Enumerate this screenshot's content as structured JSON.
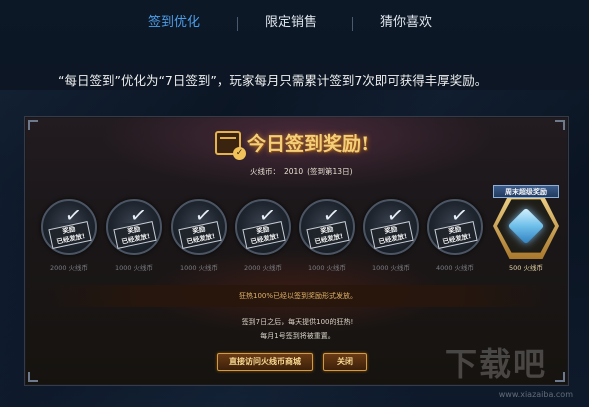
{
  "tabs": [
    {
      "label": "签到优化",
      "active": true
    },
    {
      "label": "限定销售",
      "active": false
    },
    {
      "label": "猜你喜欢",
      "active": false
    }
  ],
  "description": "“每日签到”优化为“7日签到”，玩家每月只需累计签到7次即可获得丰厚奖励。",
  "panel": {
    "title": "今日签到奖励!",
    "coin_label": "火线币：",
    "coin_value": "2010",
    "signed_days": "(签到第13日)",
    "stamp_line1": "奖励",
    "stamp_line2": "已经发放!",
    "rewards": [
      {
        "label": "2000 火线币",
        "claimed": true
      },
      {
        "label": "1000 火线币",
        "claimed": true
      },
      {
        "label": "1000 火线币",
        "claimed": true
      },
      {
        "label": "2000 火线币",
        "claimed": true
      },
      {
        "label": "1000 火线币",
        "claimed": true
      },
      {
        "label": "1000 火线币",
        "claimed": true
      },
      {
        "label": "4000 火线币",
        "claimed": true
      }
    ],
    "final_reward": {
      "tag": "周末超级奖励",
      "label": "500 火线币",
      "icon": "crystal-gem-icon"
    },
    "status_bar": "狂热100%已经以签到奖励形式发放。",
    "note1": "签到7日之后，每天提供100的狂热!",
    "note2": "每月1号签到将被重置。",
    "shop_button": "直接访问火线币商城",
    "close_button": "关闭"
  },
  "watermark": {
    "text": "下载吧",
    "url": "www.xiazaiba.com"
  },
  "colors": {
    "accent": "#4c9ee8",
    "gold": "#f4cf7a",
    "background": "#0b1624"
  }
}
